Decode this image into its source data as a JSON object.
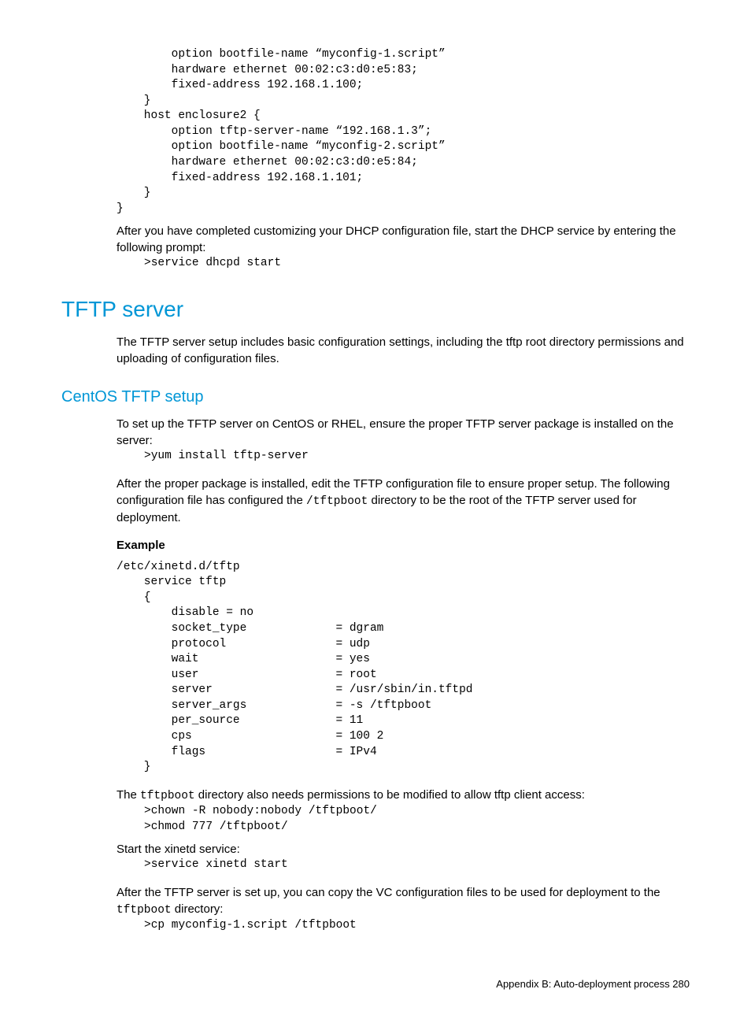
{
  "code_top": "        option bootfile-name “myconfig-1.script”\n        hardware ethernet 00:02:c3:d0:e5:83;\n        fixed-address 192.168.1.100;\n    }\n    host enclosure2 {\n        option tftp-server-name “192.168.1.3”;\n        option bootfile-name “myconfig-2.script”\n        hardware ethernet 00:02:c3:d0:e5:84;\n        fixed-address 192.168.1.101;\n    }\n}",
  "para_after_top": "After you have completed customizing your DHCP configuration file, start the DHCP service by entering the following prompt:",
  "code_dhcp_start": ">service dhcpd start",
  "h1_tftp": "TFTP server",
  "para_tftp_intro": "The TFTP server setup includes basic configuration settings, including the tftp root directory permissions and uploading of configuration files.",
  "h2_centos": "CentOS TFTP setup",
  "para_centos_intro": "To set up the TFTP server on CentOS or RHEL, ensure the proper TFTP server package is installed on the server:",
  "code_yum": ">yum install tftp-server",
  "para_after_yum_1": "After the proper package is installed, edit the TFTP configuration file to ensure proper setup. The following configuration file has configured the ",
  "mono_tftpboot": "/tftpboot",
  "para_after_yum_2": " directory to be the root of the TFTP server used for deployment.",
  "example_label": "Example",
  "code_example": "/etc/xinetd.d/tftp\n    service tftp\n    {\n        disable = no\n        socket_type             = dgram\n        protocol                = udp\n        wait                    = yes\n        user                    = root\n        server                  = /usr/sbin/in.tftpd\n        server_args             = -s /tftpboot\n        per_source              = 11\n        cps                     = 100 2\n        flags                   = IPv4\n    }",
  "para_perm_1": "The ",
  "mono_tftpboot2": "tftpboot",
  "para_perm_2": " directory also needs permissions to be modified to allow tftp client access:",
  "code_perm": ">chown -R nobody:nobody /tftpboot/\n>chmod 777 /tftpboot/",
  "para_xinetd": "Start the xinetd service:",
  "code_xinetd": ">service xinetd start",
  "para_copy_1": "After the TFTP server is set up, you can copy the VC configuration files to be used for deployment to the ",
  "mono_tftpboot3": "tftpboot",
  "para_copy_2": " directory:",
  "code_cp": ">cp myconfig-1.script /tftpboot",
  "footer_text": "Appendix B: Auto-deployment process   280"
}
